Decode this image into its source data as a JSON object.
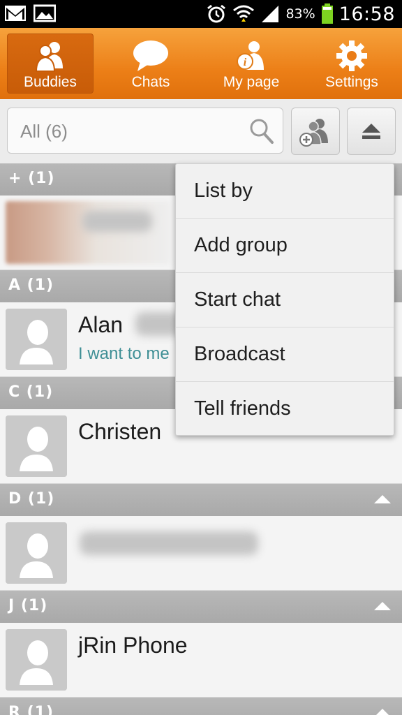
{
  "status_bar": {
    "left_icons": [
      "gmail-icon",
      "gallery-icon"
    ],
    "right_icons": [
      "alarm-icon",
      "wifi-icon",
      "signal-icon",
      "battery-icon"
    ],
    "battery_percent": "83%",
    "time": "16:58"
  },
  "tabs": [
    {
      "label": "Buddies",
      "icon": "buddies-icon",
      "active": true
    },
    {
      "label": "Chats",
      "icon": "chat-bubble-icon",
      "active": false
    },
    {
      "label": "My page",
      "icon": "my-page-icon",
      "active": false
    },
    {
      "label": "Settings",
      "icon": "gear-icon",
      "active": false
    }
  ],
  "search": {
    "filter_text": "All (6)",
    "icon": "search-icon",
    "add_buddy_icon": "add-buddy-icon",
    "menu_icon": "eject-icon"
  },
  "sections": [
    {
      "label": "+ (1)"
    },
    {
      "label": "A (1)"
    },
    {
      "label": "C (1)"
    },
    {
      "label": "D (1)"
    },
    {
      "label": "J (1)"
    },
    {
      "label": "R (1)"
    }
  ],
  "buddies": [
    {
      "name": "",
      "status": ""
    },
    {
      "name": "Alan",
      "status": "I want to me"
    },
    {
      "name": "Christen",
      "status": ""
    },
    {
      "name": "",
      "status": ""
    },
    {
      "name": "jRin Phone",
      "status": ""
    }
  ],
  "menu": {
    "items": [
      "List by",
      "Add group",
      "Start chat",
      "Broadcast",
      "Tell friends"
    ]
  },
  "colors": {
    "tab_bar": "#ec7f17",
    "tab_active": "#c85c08",
    "section_header": "#aeaeae",
    "status_text": "#3f8f95"
  }
}
